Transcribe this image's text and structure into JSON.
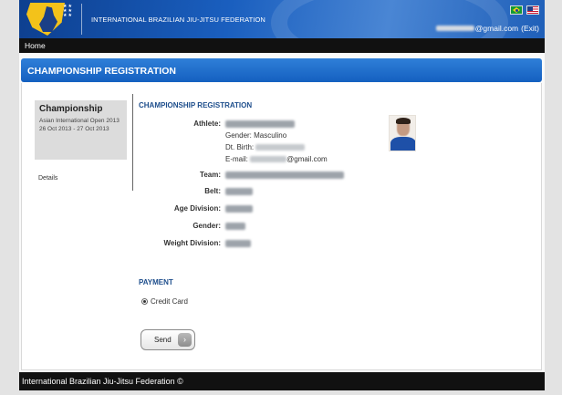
{
  "header": {
    "org_name": "INTERNATIONAL BRAZILIAN JIU-JITSU FEDERATION",
    "user_email_suffix": "@gmail.com",
    "exit_label": "(Exit)",
    "flags": [
      "brazil-flag-icon",
      "usa-flag-icon"
    ]
  },
  "nav": {
    "home": "Home"
  },
  "page_title": "CHAMPIONSHIP REGISTRATION",
  "sidebar": {
    "card_title": "Championship",
    "event_name": "Asian International Open 2013",
    "event_dates": "26 Oct 2013 - 27 Oct 2013",
    "details_link": "Details"
  },
  "registration": {
    "section_title": "CHAMPIONSHIP REGISTRATION",
    "athlete_label": "Athlete:",
    "gender_line": "Gender: Masculino",
    "dob_prefix": "Dt. Birth:",
    "email_prefix": "E-mail:",
    "email_suffix": "@gmail.com",
    "team_label": "Team:",
    "belt_label": "Belt:",
    "age_division_label": "Age Division:",
    "gender_label": "Gender:",
    "weight_division_label": "Weight Division:"
  },
  "payment": {
    "section_title": "PAYMENT",
    "option": "Credit Card",
    "send_label": "Send"
  },
  "footer": {
    "text": "International Brazilian Jiu-Jitsu Federation ©"
  },
  "colors": {
    "header_blue": "#1460c0",
    "section_title": "#1e4e8c",
    "bar_black": "#111111"
  }
}
